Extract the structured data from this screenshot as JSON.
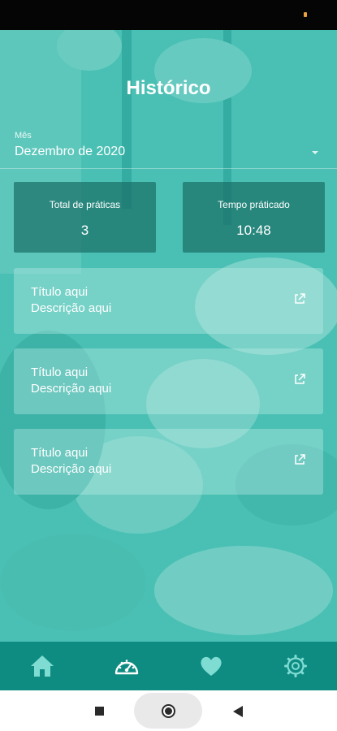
{
  "header": {
    "title": "Histórico"
  },
  "month": {
    "label": "Mês",
    "value": "Dezembro de 2020"
  },
  "stats": {
    "total": {
      "label": "Total de práticas",
      "value": "3"
    },
    "time": {
      "label": "Tempo práticado",
      "value": "10:48"
    }
  },
  "items": [
    {
      "title": "Título aqui",
      "description": "Descrição aqui"
    },
    {
      "title": "Título aqui",
      "description": "Descrição aqui"
    },
    {
      "title": "Título aqui",
      "description": "Descrição aqui"
    }
  ],
  "bottom_nav": {
    "items": [
      {
        "icon": "home-icon"
      },
      {
        "icon": "dashboard-gauge-icon"
      },
      {
        "icon": "heart-icon"
      },
      {
        "icon": "settings-gear-icon"
      }
    ]
  },
  "colors": {
    "background_tint": "#3fbcb2",
    "stat_card": "#1a7068",
    "bottom_nav": "#0f8c82",
    "nav_icon": "#7fdcd3",
    "nav_icon_active": "#ffffff"
  }
}
